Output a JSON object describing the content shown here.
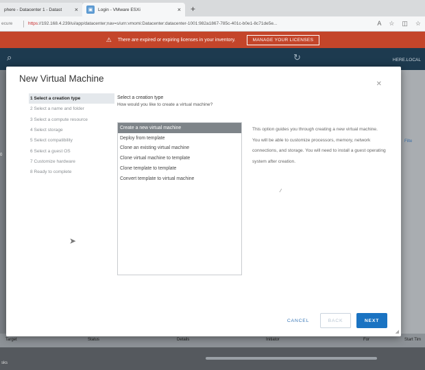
{
  "browser": {
    "tabs": [
      {
        "label": "phere - Datacenter 1 - Datast"
      },
      {
        "label": "Login - VMware ESXi"
      }
    ],
    "new_tab": "+",
    "address": {
      "secure_label": "ecure",
      "https": "https",
      "rest": "://192.168.4.239/ui/app/datacenter;nav=s/urn:vmomi:Datacenter:datacenter-1001:982a1867-785c-401c-b0e1-8c71de5e..."
    }
  },
  "banner": {
    "text": "There are expired or expiring licenses in your inventory.",
    "button": "MANAGE YOUR LICENSES",
    "color": "#c4452a"
  },
  "header": {
    "user": "HERE.LOCAL"
  },
  "background": {
    "filter": "Filte",
    "left_mark": "0",
    "columns": [
      "Target",
      "Status",
      "Details",
      "Initiator",
      "For",
      "Start Tim"
    ],
    "tasks": "sks"
  },
  "modal": {
    "title": "New Virtual Machine",
    "steps": [
      "1 Select a creation type",
      "2 Select a name and folder",
      "3 Select a compute resource",
      "4 Select storage",
      "5 Select compatibility",
      "6 Select a guest OS",
      "7 Customize hardware",
      "8 Ready to complete"
    ],
    "content_heading": "Select a creation type",
    "content_sub": "How would you like to create a virtual machine?",
    "creation_types": [
      "Create a new virtual machine",
      "Deploy from template",
      "Clone an existing virtual machine",
      "Clone virtual machine to template",
      "Clone template to template",
      "Convert template to virtual machine"
    ],
    "selected_index": 0,
    "description": "This option guides you through creating a new virtual machine. You will be able to customize processors, memory, network connections, and storage. You will need to install a guest operating system after creation.",
    "buttons": {
      "cancel": "CANCEL",
      "back": "BACK",
      "next": "NEXT"
    },
    "accent": "#1a73c2"
  }
}
